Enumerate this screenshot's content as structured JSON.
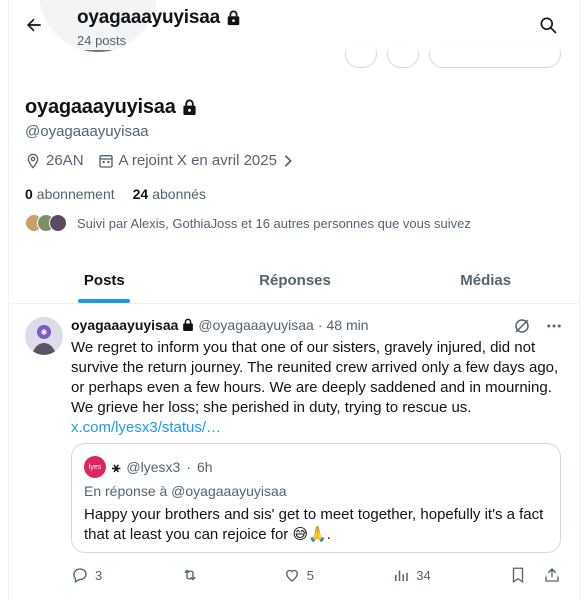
{
  "header": {
    "title": "oyagaaayuyisaa",
    "posts_count": "24 posts"
  },
  "profile": {
    "display_name": "oyagaaayuyisaa",
    "handle": "@oyagaaayuyisaa",
    "location": "26AN",
    "joined": "A rejoint X en avril 2025",
    "following_count": "0",
    "following_label": "abonnement",
    "followers_count": "24",
    "followers_label": "abonnés",
    "followed_by": "Suivi par Alexis, GothiaJoss et 16 autres personnes que vous suivez"
  },
  "tabs": [
    {
      "label": "Posts"
    },
    {
      "label": "Réponses"
    },
    {
      "label": "Médias"
    }
  ],
  "tweet": {
    "name": "oyagaaayuyisaa",
    "handle": "@oyagaaayuyisaa",
    "dot": "·",
    "time": "48 min",
    "text": "We regret to inform you that one of our sisters, gravely injured, did not survive the return journey. The reunited crew arrived only a few days ago, or perhaps even a few hours. We are deeply saddened and in mourning. We grieve her loss; she perished in duty, trying to rescue us.",
    "link": "x.com/lyesx3/status/…",
    "quote": {
      "avatar_text": "lyes",
      "name_symbol": "⚹",
      "handle": "@lyesx3",
      "dot": "·",
      "time": "6h",
      "reply_to": "En réponse à @oyagaaayuyisaa",
      "text": "Happy your brothers and sis' get to meet together, hopefully it's a fact that at least you can rejoice for 😅🙏."
    },
    "actions": {
      "replies": "3",
      "reposts": "",
      "likes": "5",
      "views": "34"
    }
  },
  "colors": {
    "accent": "#1d9bf0",
    "text": "#0f1419",
    "muted": "#536471",
    "border": "#cfd9de"
  }
}
